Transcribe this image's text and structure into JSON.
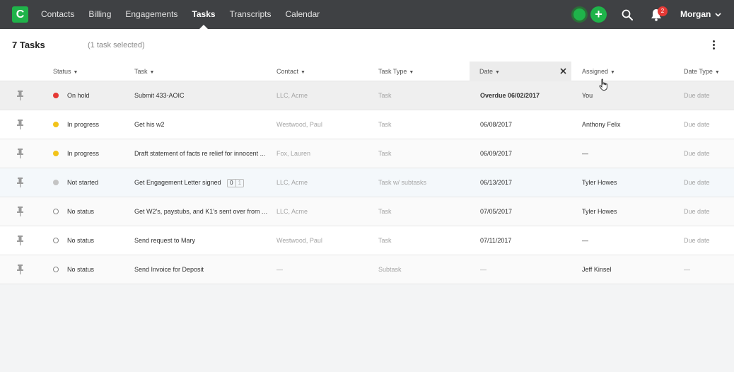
{
  "app": {
    "logo_letter": "C",
    "nav": [
      {
        "label": "Contacts",
        "active": false
      },
      {
        "label": "Billing",
        "active": false
      },
      {
        "label": "Engagements",
        "active": false
      },
      {
        "label": "Tasks",
        "active": true
      },
      {
        "label": "Transcripts",
        "active": false
      },
      {
        "label": "Calendar",
        "active": false
      }
    ],
    "add_label": "+",
    "notifications_count": "2",
    "user_name": "Morgan",
    "icons": [
      "search-icon",
      "bell-icon",
      "chevron-down-icon",
      "plus-icon",
      "pin-icon",
      "close-icon",
      "kebab-menu-icon",
      "hand-cursor-icon"
    ]
  },
  "tasks_panel": {
    "title": "7 Tasks",
    "selection": "(1 task selected)",
    "columns": {
      "status": "Status",
      "task": "Task",
      "contact": "Contact",
      "task_type": "Task Type",
      "date": "Date",
      "assigned": "Assigned",
      "date_type": "Date Type"
    },
    "rows": [
      {
        "status": "On hold",
        "status_color": "#e53935",
        "task": "Submit 433-AOIC",
        "contact": "LLC, Acme",
        "task_type": "Task",
        "date": "Overdue 06/02/2017",
        "assigned": "You",
        "date_type": "Due date"
      },
      {
        "status": "In progress",
        "status_color": "#f2c31a",
        "task": "Get his w2",
        "contact": "Westwood, Paul",
        "task_type": "Task",
        "date": "06/08/2017",
        "assigned": "Anthony Felix",
        "date_type": "Due date"
      },
      {
        "status": "In progress",
        "status_color": "#f2c31a",
        "task": "Draft statement of facts re relief for innocent ...",
        "contact": "Fox, Lauren",
        "task_type": "Task",
        "date": "06/09/2017",
        "assigned": "—",
        "date_type": "Due date"
      },
      {
        "status": "Not started",
        "status_color": "#c4c4c4",
        "task": "Get Engagement Letter signed",
        "subtasks_done": "0",
        "subtasks_total": "1",
        "contact": "LLC, Acme",
        "task_type": "Task w/ subtasks",
        "date": "06/13/2017",
        "assigned": "Tyler Howes",
        "date_type": "Due date"
      },
      {
        "status": "No status",
        "status_color": "#ffffff",
        "task": "Get W2's, paystubs, and K1's sent over from Ac...",
        "contact": "LLC, Acme",
        "task_type": "Task",
        "date": "07/05/2017",
        "assigned": "Tyler Howes",
        "date_type": "Due date"
      },
      {
        "status": "No status",
        "status_color": "#ffffff",
        "task": "Send request to Mary",
        "contact": "Westwood, Paul",
        "task_type": "Task",
        "date": "07/11/2017",
        "assigned": "—",
        "date_type": "Due date"
      },
      {
        "status": "No status",
        "status_color": "#ffffff",
        "task": "Send Invoice for Deposit",
        "contact": "—",
        "task_type": "Subtask",
        "date": "—",
        "assigned": "Jeff Kinsel",
        "date_type": "—"
      }
    ]
  }
}
